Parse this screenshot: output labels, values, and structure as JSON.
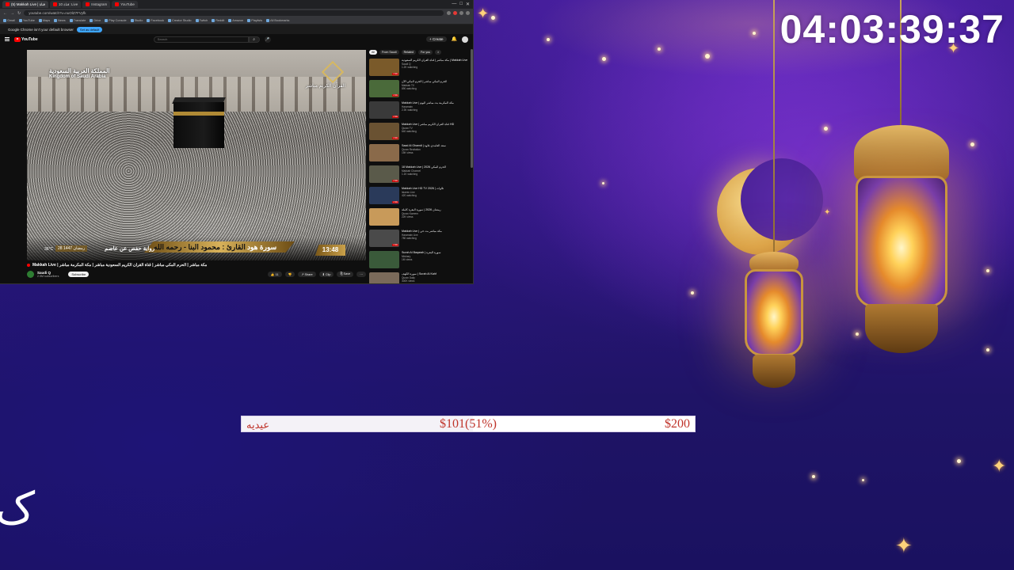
{
  "overlay": {
    "countdown": "04:03:39:37",
    "goal": {
      "name": "عيديه",
      "current": "$101(51%)",
      "target": "$200",
      "progress": 0.51
    },
    "edge_glyph": "ک",
    "colors": {
      "goal_text": "#c0352b",
      "background": "#2a1370",
      "lantern_glow": "#ffd25a"
    }
  },
  "browser": {
    "tabs": [
      {
        "label": "(5) Makkah Live | قناة",
        "active": true
      },
      {
        "label": "قناة 10: Live"
      },
      {
        "label": "Instagram"
      },
      {
        "label": "YouTube"
      }
    ],
    "url": "youtube.com/watch?v=nuOlZ7FVyfk",
    "bookmarks": [
      "Gmail",
      "YouTube",
      "Maps",
      "News",
      "Translate",
      "Drive",
      "Play Console",
      "Studio",
      "Facebook",
      "Creator Studio",
      "Twitch",
      "Reddit",
      "Amazon",
      "Playlists",
      "All Bookmarks"
    ],
    "notice": {
      "text": "Google Chrome isn't your default browser",
      "button": "Set as default"
    },
    "youtube": {
      "logo": "YouTube",
      "search_placeholder": "Search",
      "create_label": "+ Create",
      "video": {
        "watermark_ar": "المملكة العربية السعودية",
        "watermark_en": "Kingdom of Saudi Arabia",
        "channel_logo_text": "القرآن الكريم مباشر",
        "reader": "القارئ : محمود البنا - رحمه الله",
        "surah": "سورة هود",
        "riwaya": "رواية حفص عن عاصم",
        "temperature": "36°C",
        "date": "28 رمضان 1447",
        "clock": "13:48",
        "title": "Makkah Live | مكة مباشر | الحرم المكي مباشر | قناة القرآن الكريم السعودية مباشر | مكة المكرمة مباشر"
      },
      "channel": {
        "name": "Saudi Q",
        "subs": "2.5M subscribers",
        "subscribe_label": "Subscribe"
      },
      "actions": [
        "👍 11",
        "👎",
        "↗ Share",
        "⬇ Clip",
        "⎘ Save",
        "⋯"
      ],
      "chips": [
        "All",
        "From Saudi",
        "Related",
        "For you",
        ">"
      ],
      "recommendations": [
        {
          "title": "مكة مباشر | قناة القرآن الكريم السعودية | Makkah Live",
          "channel": "Saudi Q",
          "stats": "1.2K watching",
          "thumb": "#7a5a2a",
          "live": true
        },
        {
          "title": "الحرم المكي مباشر | الحرم المكي الآن",
          "channel": "Makkah TV",
          "stats": "890 watching",
          "thumb": "#4a6a3a",
          "live": true
        },
        {
          "title": "Makkah Live | مكة المكرمة بث مباشر اليوم",
          "channel": "Haramain",
          "stats": "2.3K watching",
          "thumb": "#3a3a3a",
          "live": true
        },
        {
          "title": "Makkah Live | قناة القرآن الكريم مباشر HD",
          "channel": "Quran TV",
          "stats": "640 watching",
          "thumb": "#6a5232",
          "live": true
        },
        {
          "title": "Saad Al Ghamdi | سعد الغامدي تلاوة",
          "channel": "Quran Recitation",
          "stats": "15K views",
          "thumb": "#8a6a4a",
          "live": false
        },
        {
          "title": "18 Makkah Live | الحرم المكي 2026",
          "channel": "Makkah Channel",
          "stats": "1.1K watching",
          "thumb": "#5a5a4a",
          "live": true
        },
        {
          "title": "Makkah Live HD TV 2026 | تلاوات",
          "channel": "Islamic Live",
          "stats": "420 watching",
          "thumb": "#2a3a5a",
          "live": true
        },
        {
          "title": "رمضان 2026 | سورة البقرة كاملة",
          "channel": "Quran Kareem",
          "stats": "22K views",
          "thumb": "#c89a5a",
          "live": false
        },
        {
          "title": "Makkah Live | مكة مباشر بث حي",
          "channel": "Haramain Live",
          "stats": "780 watching",
          "thumb": "#4a4a4a",
          "live": true
        },
        {
          "title": "Surah Al Baqarah | سورة البقرة",
          "channel": "Mishary",
          "stats": "1M views",
          "thumb": "#3a5a3a",
          "live": false
        },
        {
          "title": "سورة الكهف | Surah Al Kahf",
          "channel": "Quran Daily",
          "stats": "300K views",
          "thumb": "#7a6a5a",
          "live": false
        }
      ]
    }
  }
}
